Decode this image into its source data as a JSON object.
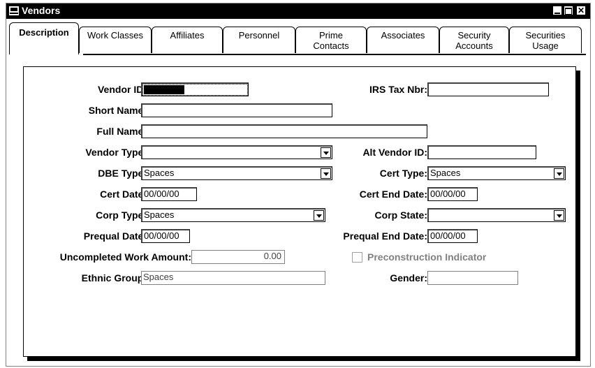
{
  "window": {
    "title": "Vendors"
  },
  "tabs": [
    {
      "label": "Description"
    },
    {
      "label": "Work Classes"
    },
    {
      "label": "Affiliates"
    },
    {
      "label": "Personnel"
    },
    {
      "label": "Prime Contacts"
    },
    {
      "label": "Associates"
    },
    {
      "label": "Security Accounts"
    },
    {
      "label": "Securities Usage"
    }
  ],
  "form": {
    "vendor_id": {
      "label": "Vendor ID:",
      "value": ""
    },
    "irs_tax_nbr": {
      "label": "IRS Tax  Nbr:",
      "value": ""
    },
    "short_name": {
      "label": "Short Name:",
      "value": ""
    },
    "full_name": {
      "label": "Full Name:",
      "value": ""
    },
    "vendor_type": {
      "label": "Vendor Type:",
      "value": ""
    },
    "alt_vendor_id": {
      "label": "Alt Vendor ID:",
      "value": ""
    },
    "dbe_type": {
      "label": "DBE Type:",
      "value": "Spaces"
    },
    "cert_type": {
      "label": "Cert Type:",
      "value": "Spaces"
    },
    "cert_date": {
      "label": "Cert Date:",
      "value": "00/00/00"
    },
    "cert_end_date": {
      "label": "Cert End Date:",
      "value": "00/00/00"
    },
    "corp_type": {
      "label": "Corp Type:",
      "value": "Spaces"
    },
    "corp_state": {
      "label": "Corp State:",
      "value": ""
    },
    "prequal_date": {
      "label": "Prequal Date:",
      "value": "00/00/00"
    },
    "prequal_end_date": {
      "label": "Prequal End Date:",
      "value": "00/00/00"
    },
    "uncompleted_work_amount": {
      "label": "Uncompleted Work Amount:",
      "value": "0.00"
    },
    "preconstruction_indicator": {
      "label": "Preconstruction Indicator",
      "checked": false
    },
    "ethnic_group": {
      "label": "Ethnic Group:",
      "value": "Spaces"
    },
    "gender": {
      "label": "Gender:",
      "value": ""
    }
  },
  "colors": {
    "titlebar": "#000000",
    "disabled_text": "#808080"
  }
}
